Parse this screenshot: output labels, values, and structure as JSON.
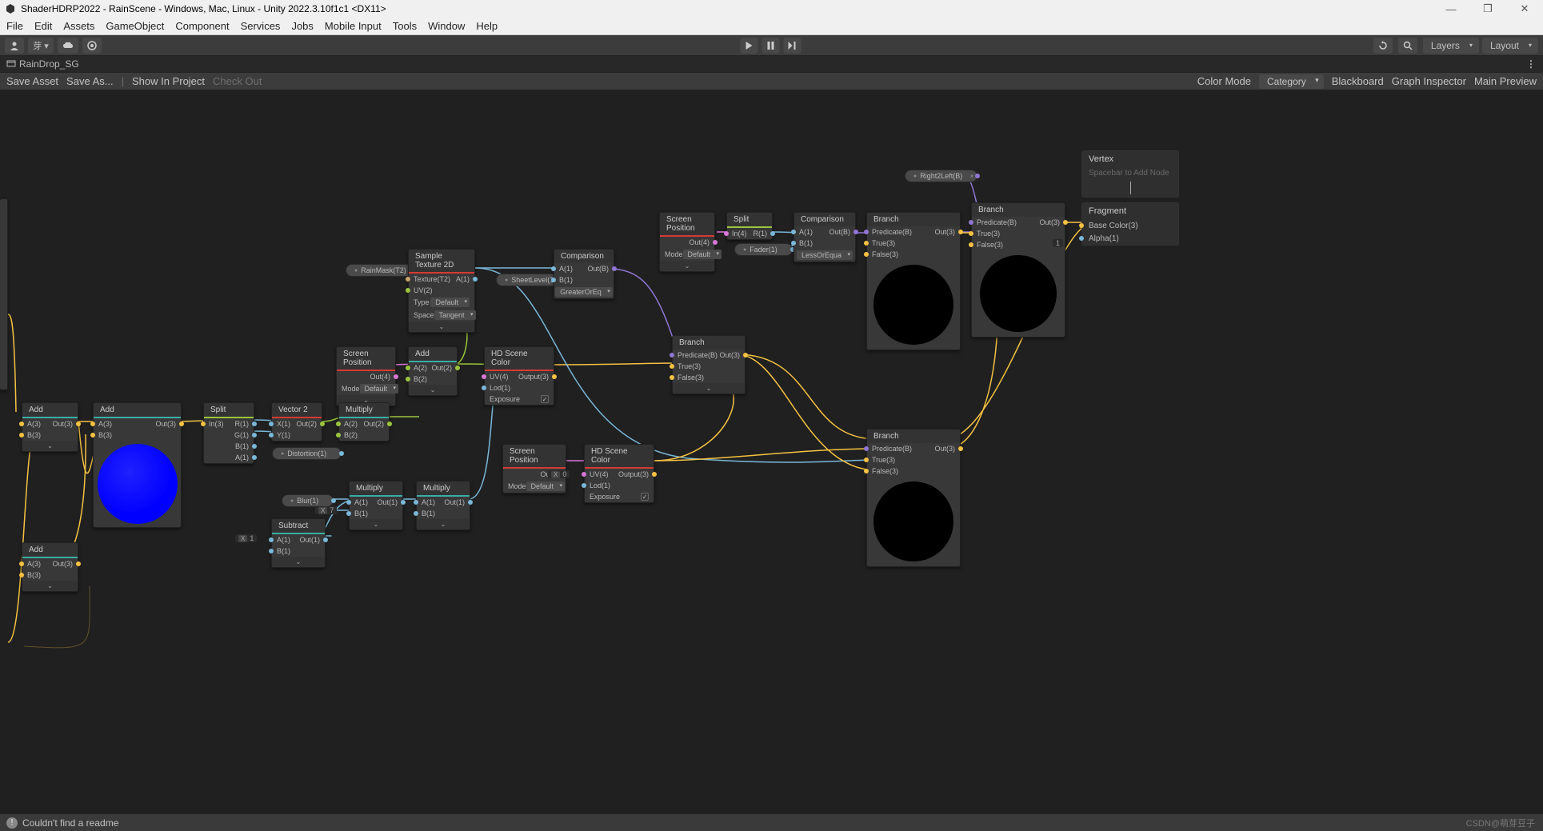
{
  "title": "ShaderHDRP2022 - RainScene - Windows, Mac, Linux - Unity 2022.3.10f1c1 <DX11>",
  "menu": [
    "File",
    "Edit",
    "Assets",
    "GameObject",
    "Component",
    "Services",
    "Jobs",
    "Mobile Input",
    "Tools",
    "Window",
    "Help"
  ],
  "toolbar": {
    "layers": "Layers",
    "layout": "Layout"
  },
  "tab": {
    "name": "RainDrop_SG"
  },
  "asset_bar": {
    "save": "Save Asset",
    "saveas": "Save As...",
    "show": "Show In Project",
    "checkout": "Check Out",
    "colormode_label": "Color Mode",
    "colormode": "Category",
    "blackboard": "Blackboard",
    "graphinspector": "Graph Inspector",
    "mainpreview": "Main Preview"
  },
  "status": {
    "warn": "Couldn't find a readme",
    "watermark": "CSDN@萌芽豆子"
  },
  "context": {
    "vertex": {
      "title": "Vertex",
      "hint": "Spacebar to Add Node"
    },
    "fragment": {
      "title": "Fragment",
      "base": "Base Color(3)",
      "alpha": "Alpha(1)"
    }
  },
  "pills": {
    "rainmask": "RainMask(T2)",
    "sheetlevel": "SheetLevel(1)",
    "distortion": "Distortion(1)",
    "blur": "Blur(1)",
    "fader": "Fader(1)",
    "right2left": "Right2Left(B)"
  },
  "nodes": {
    "add1": {
      "title": "Add",
      "a": "A(3)",
      "b": "B(3)",
      "out": "Out(3)"
    },
    "add_trunc": {
      "title": "Add",
      "a": "A(3)",
      "out": "Out(3)"
    },
    "add2": {
      "title": "Add",
      "a": "A(3)",
      "b": "B(3)",
      "out": "Out(3)"
    },
    "split": {
      "title": "Split",
      "in": "In(3)",
      "r": "R(1)",
      "g": "G(1)",
      "b": "B(1)",
      "a": "A(1)"
    },
    "vec2": {
      "title": "Vector 2",
      "x": "X(1)",
      "y": "Y(1)",
      "out": "Out(2)"
    },
    "screenpos1": {
      "title": "Screen Position",
      "out": "Out(4)",
      "mode": "Mode",
      "modeval": "Default"
    },
    "multiply1": {
      "title": "Multiply",
      "a": "A(2)",
      "b": "B(2)",
      "out": "Out(2)"
    },
    "add3": {
      "title": "Add",
      "a": "A(2)",
      "b": "B(2)",
      "out": "Out(2)"
    },
    "sampletex": {
      "title": "Sample Texture 2D",
      "tex": "Texture(T2)",
      "uv": "UV(2)",
      "a": "A(1)",
      "type": "Type",
      "typeval": "Default",
      "space": "Space",
      "spaceval": "Tangent"
    },
    "hdscene1": {
      "title": "HD Scene Color",
      "uv": "UV(4)",
      "lod": "Lod(1)",
      "exposure": "Exposure",
      "out": "Output(3)"
    },
    "comp1": {
      "title": "Comparison",
      "a": "A(1)",
      "b": "B(1)",
      "out": "Out(B)",
      "op": "GreaterOrEq"
    },
    "multiply2": {
      "title": "Multiply",
      "a": "A(1)",
      "b": "B(1)",
      "out": "Out(1)"
    },
    "multiply3": {
      "title": "Multiply",
      "a": "A(1)",
      "b": "B(1)",
      "out": "Out(1)"
    },
    "subtract": {
      "title": "Subtract",
      "a": "A(1)",
      "b": "B(1)",
      "out": "Out(1)"
    },
    "screenpos2": {
      "title": "Screen Position",
      "out": "Out(4)",
      "mode": "Mode",
      "modeval": "Default"
    },
    "hdscene2": {
      "title": "HD Scene Color",
      "uv": "UV(4)",
      "lod": "Lod(1)",
      "exposure": "Exposure",
      "out": "Output(3)"
    },
    "screenpos3": {
      "title": "Screen Position",
      "out": "Out(4)",
      "mode": "Mode",
      "modeval": "Default"
    },
    "split2": {
      "title": "Split",
      "in": "In(4)",
      "r": "R(1)"
    },
    "comp2": {
      "title": "Comparison",
      "a": "A(1)",
      "b": "B(1)",
      "out": "Out(B)",
      "op": "LessOrEqua"
    },
    "branch1": {
      "title": "Branch",
      "pred": "Predicate(B)",
      "t": "True(3)",
      "f": "False(3)",
      "out": "Out(3)"
    },
    "branch_mid": {
      "title": "Branch",
      "pred": "Predicate(B)",
      "t": "True(3)",
      "f": "False(3)",
      "out": "Out(3)"
    },
    "branch2": {
      "title": "Branch",
      "pred": "Predicate(B)",
      "t": "True(3)",
      "f": "False(3)",
      "out": "Out(3)"
    },
    "branch3": {
      "title": "Branch",
      "pred": "Predicate(B)",
      "t": "True(3)",
      "f": "False(3)",
      "out": "Out(3)"
    }
  },
  "numfields": {
    "seven": "7",
    "one": "1",
    "zero": "0"
  }
}
